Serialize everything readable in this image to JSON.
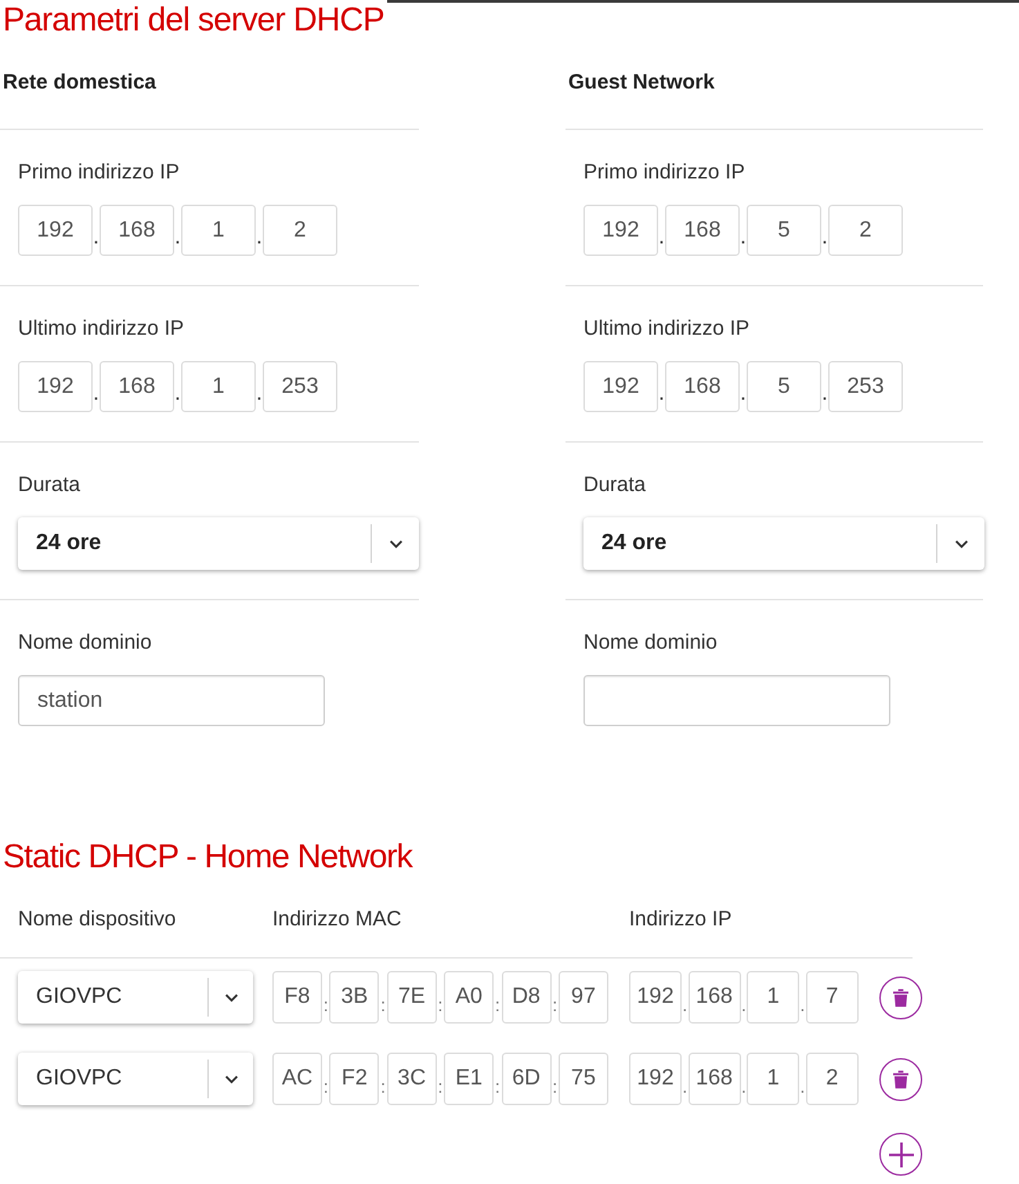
{
  "title": "Parametri del server DHCP",
  "networks": [
    {
      "heading": "Rete domestica",
      "fields": [
        {
          "kind": "ip",
          "label": "Primo indirizzo IP",
          "separator": ".",
          "octets": [
            "192",
            "168",
            "1",
            "2"
          ]
        },
        {
          "kind": "ip",
          "label": "Ultimo indirizzo IP",
          "separator": ".",
          "octets": [
            "192",
            "168",
            "1",
            "253"
          ]
        },
        {
          "kind": "select",
          "label": "Durata",
          "value": "24 ore"
        },
        {
          "kind": "text",
          "label": "Nome dominio",
          "value": "station"
        }
      ]
    },
    {
      "heading": "Guest Network",
      "fields": [
        {
          "kind": "ip",
          "label": "Primo indirizzo IP",
          "separator": ".",
          "octets": [
            "192",
            "168",
            "5",
            "2"
          ]
        },
        {
          "kind": "ip",
          "label": "Ultimo indirizzo IP",
          "separator": ".",
          "octets": [
            "192",
            "168",
            "5",
            "253"
          ]
        },
        {
          "kind": "select",
          "label": "Durata",
          "value": "24 ore"
        },
        {
          "kind": "text",
          "label": "Nome dominio"
        }
      ]
    }
  ],
  "static_dhcp": {
    "title": "Static DHCP - Home Network",
    "columns": [
      "Nome dispositivo",
      "Indirizzo MAC",
      "Indirizzo IP"
    ],
    "mac_separator": ":",
    "ip_separator": ".",
    "rows": [
      {
        "device": "GIOVPC",
        "mac": [
          "F8",
          "3B",
          "7E",
          "A0",
          "D8",
          "97"
        ],
        "ip": [
          "192",
          "168",
          "1",
          "7"
        ]
      },
      {
        "device": "GIOVPC",
        "mac": [
          "AC",
          "F2",
          "3C",
          "E1",
          "6D",
          "75"
        ],
        "ip": [
          "192",
          "168",
          "1",
          "2"
        ]
      }
    ]
  }
}
